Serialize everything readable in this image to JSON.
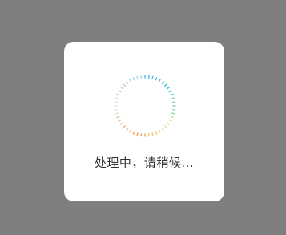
{
  "loading_dialog": {
    "message": "处理中，请稍候...",
    "spinner": {
      "icon": "loading-spinner-icon",
      "colors": [
        "#4fb6e6",
        "#38c7d8",
        "#8fd3a8",
        "#d8e28f",
        "#f2c66e",
        "#f0a64a",
        "#e7b878",
        "#e3e3e3",
        "#c8c8c8",
        "#9fd6ef"
      ]
    }
  }
}
